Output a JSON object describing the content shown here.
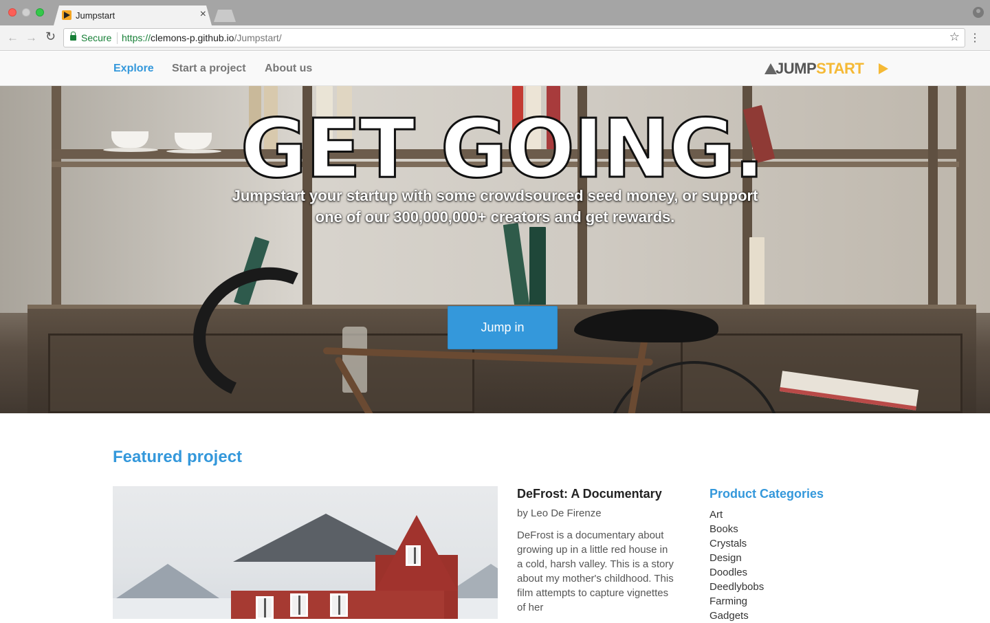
{
  "browser": {
    "tab_title": "Jumpstart",
    "tab_close": "×",
    "secure_label": "Secure",
    "url_scheme": "https://",
    "url_host": "clemons-p.github.io",
    "url_path": "/Jumpstart/"
  },
  "nav": {
    "items": [
      {
        "label": "Explore",
        "active": true
      },
      {
        "label": "Start a project",
        "active": false
      },
      {
        "label": "About us",
        "active": false
      }
    ],
    "logo_dark": "JUMP",
    "logo_gold": "START"
  },
  "hero": {
    "title": "GET GOING.",
    "subtitle_line1": "Jumpstart your startup with some crowdsourced seed money, or support",
    "subtitle_line2": "one of our 300,000,000+ creators and get rewards.",
    "cta_label": "Jump in"
  },
  "featured": {
    "heading": "Featured project",
    "project_title": "DeFrost: A Documentary",
    "project_author": "by Leo De Firenze",
    "project_description": "DeFrost is a documentary about growing up in a little red house in a cold, harsh valley. This is a story about my mother's childhood. This film attempts to capture vignettes of her"
  },
  "categories": {
    "heading": "Product Categories",
    "items": [
      "Art",
      "Books",
      "Crystals",
      "Design",
      "Doodles",
      "Deedlybobs",
      "Farming",
      "Gadgets"
    ]
  },
  "colors": {
    "accent": "#3498db",
    "logo_gold": "#f5b935",
    "secure_green": "#188038"
  }
}
